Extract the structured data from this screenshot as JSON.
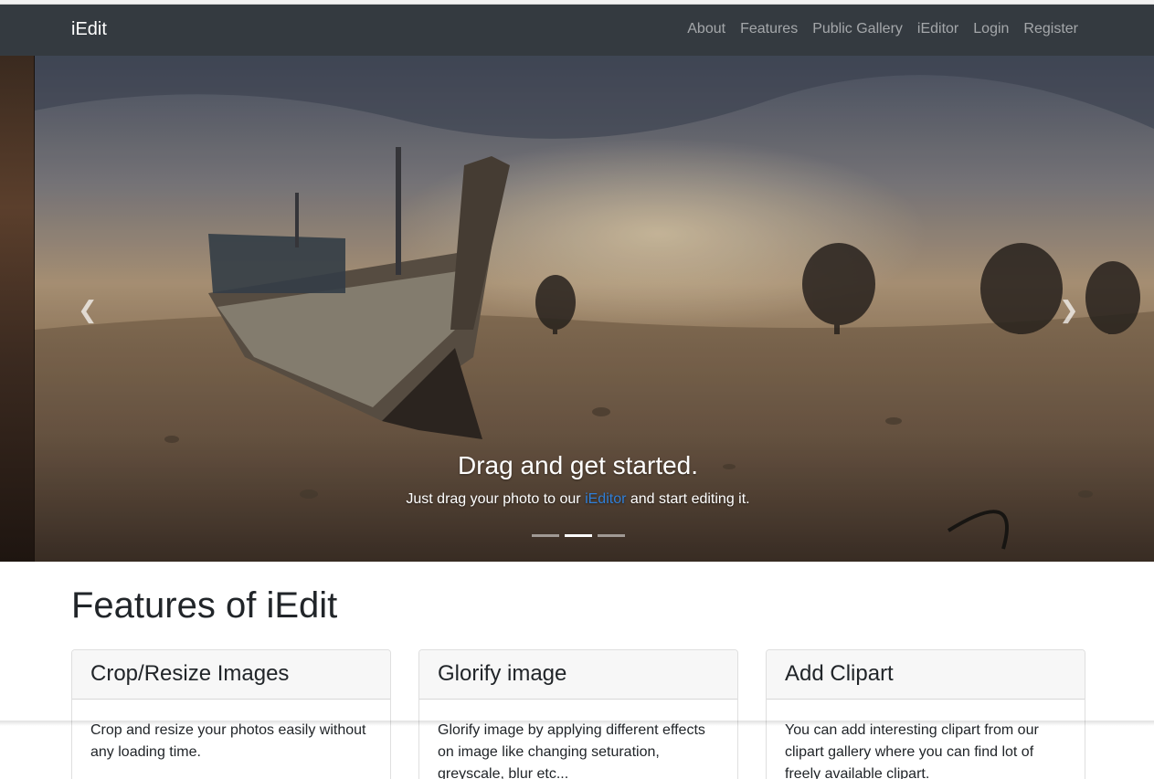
{
  "navbar": {
    "brand": "iEdit",
    "links": [
      "About",
      "Features",
      "Public Gallery",
      "iEditor",
      "Login",
      "Register"
    ]
  },
  "carousel": {
    "prev_icon": "chevron-left-icon",
    "next_icon": "chevron-right-icon",
    "caption_title": "Drag and get started.",
    "caption_text_before": "Just drag your photo to our ",
    "caption_link": "iEditor",
    "caption_text_after": " and start editing it.",
    "indicator_count": 3,
    "active_indicator": 2
  },
  "features": {
    "heading": "Features of iEdit",
    "cards": [
      {
        "title": "Crop/Resize Images",
        "text": "Crop and resize your photos easily without any loading time."
      },
      {
        "title": "Glorify image",
        "text": "Glorify image by applying different effects on image like changing seturation, greyscale, blur etc..."
      },
      {
        "title": "Add Clipart",
        "text": "You can add interesting clipart from our clipart gallery where you can find lot of freely available clipart."
      }
    ]
  },
  "colors": {
    "navbar_bg": "#343a40",
    "link_blue": "#2f7fd8"
  }
}
